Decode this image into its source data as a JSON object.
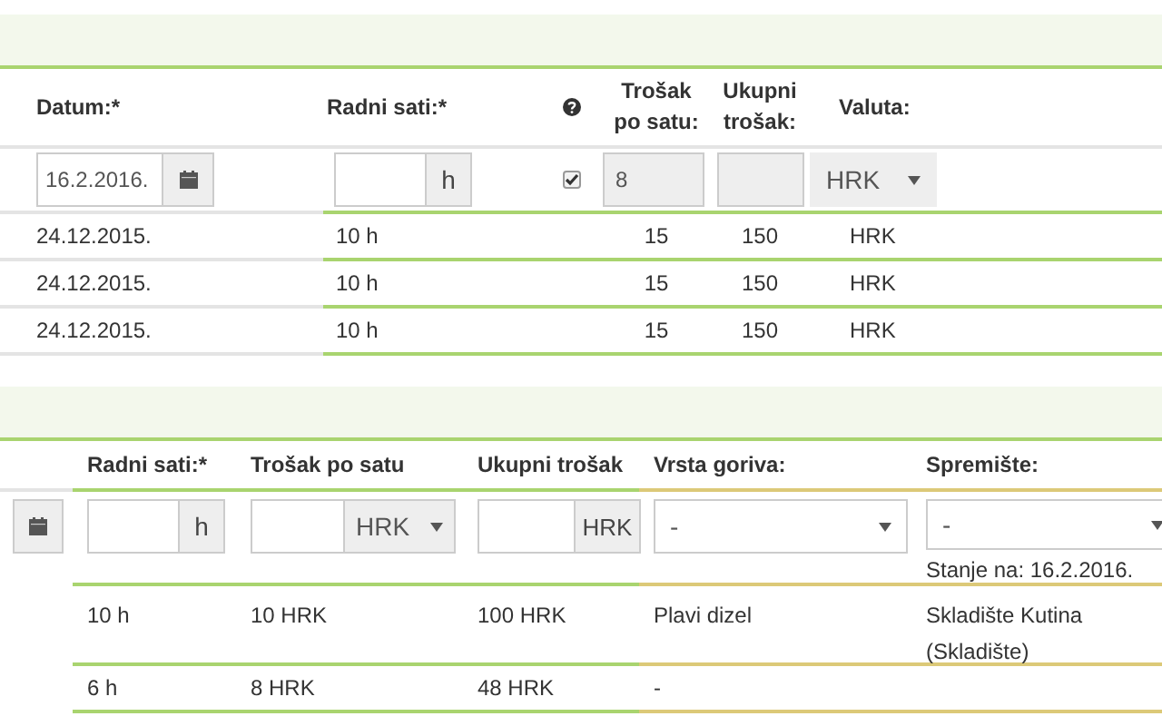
{
  "section1": {
    "headers": {
      "date": "Datum:*",
      "hours": "Radni sati:*",
      "rate": "Trošak po satu:",
      "total": "Ukupni trošak:",
      "currency": "Valuta:"
    },
    "entry": {
      "date": "16.2.2016.",
      "hours_unit": "h",
      "billable": true,
      "rate": "8",
      "currency": "HRK"
    },
    "rows": [
      {
        "date": "24.12.2015.",
        "hours": "10 h",
        "rate": "15",
        "total": "150",
        "currency": "HRK"
      },
      {
        "date": "24.12.2015.",
        "hours": "10 h",
        "rate": "15",
        "total": "150",
        "currency": "HRK"
      },
      {
        "date": "24.12.2015.",
        "hours": "10 h",
        "rate": "15",
        "total": "150",
        "currency": "HRK"
      }
    ]
  },
  "section2": {
    "headers": {
      "hours": "Radni sati:*",
      "rate": "Trošak po satu",
      "total": "Ukupni trošak",
      "fuel": "Vrsta goriva:",
      "storage": "Spremište:"
    },
    "entry": {
      "hours_unit": "h",
      "rate_currency": "HRK",
      "total_currency": "HRK",
      "fuel": "-",
      "storage": "-",
      "stock_note": "Stanje na: 16.2.2016."
    },
    "rows": [
      {
        "hours": "10 h",
        "rate": "10 HRK",
        "total": "100 HRK",
        "fuel": "Plavi dizel",
        "storage": "Skladište Kutina (Skladište)"
      },
      {
        "hours": "6 h",
        "rate": "8 HRK",
        "total": "48 HRK",
        "fuel": "-"
      }
    ]
  }
}
